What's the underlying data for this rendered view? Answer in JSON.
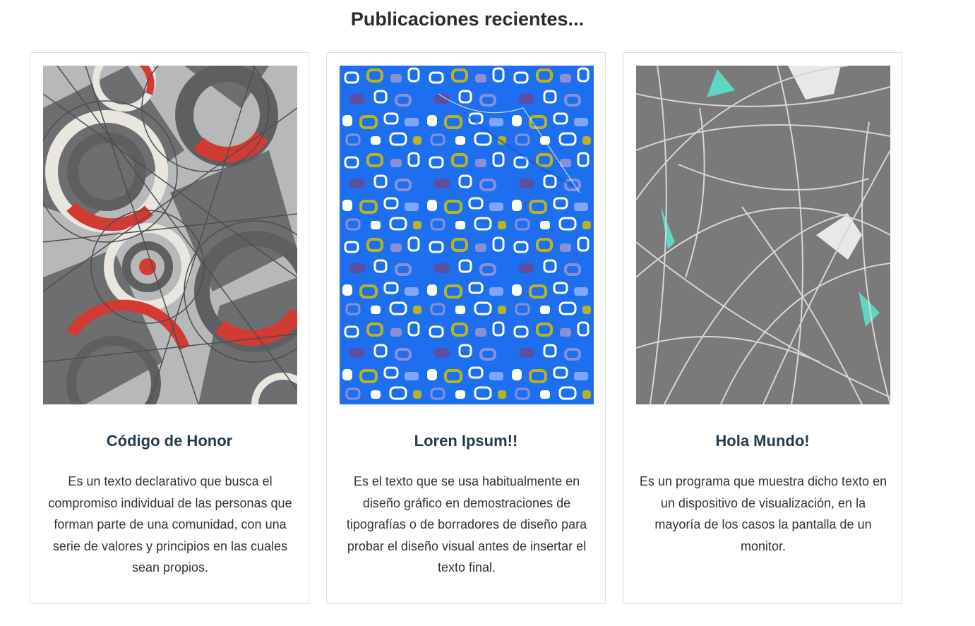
{
  "section": {
    "title": "Publicaciones recientes..."
  },
  "cards": [
    {
      "image_icon": "abstract-circles-pattern-image",
      "title": "Código de Honor",
      "text": "Es un texto declarativo que busca el compromiso individual de las personas que forman parte de una comunidad, con una serie de valores y principios en las cuales sean propios."
    },
    {
      "image_icon": "blue-shapes-pattern-image",
      "title": "Loren Ipsum!!",
      "text": "Es el texto que se usa habitualmente en diseño gráfico en demostraciones de tipografías o de borradores de diseño para probar el diseño visual antes de insertar el texto final."
    },
    {
      "image_icon": "gray-lines-pattern-image",
      "title": "Hola Mundo!",
      "text": "Es un programa que muestra dicho texto en un dispositivo de visualización, en la mayoría de los casos la pantalla de un monitor."
    }
  ],
  "colors": {
    "title_text": "#243b4a",
    "body_text": "#333333",
    "card_border": "#dcdcdc",
    "pattern_gray": "#6d6e70",
    "pattern_light_gray": "#b5b6b7",
    "pattern_red": "#d33a34",
    "pattern_blue": "#1e6ff0",
    "pattern_olive": "#b9b320",
    "pattern_lavender": "#8a8fd6",
    "pattern_teal": "#5fd6c4"
  }
}
